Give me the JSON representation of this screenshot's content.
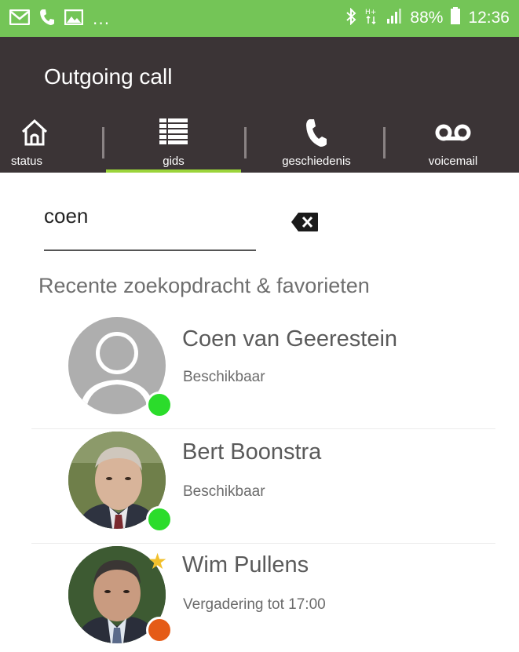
{
  "status_bar": {
    "battery": "88%",
    "time": "12:36",
    "dots": "...",
    "icons": [
      "mail-icon",
      "phone-icon",
      "image-icon",
      "bluetooth-icon",
      "mobile-data-icon",
      "signal-icon",
      "battery-icon"
    ]
  },
  "header": {
    "title": "Outgoing call",
    "active_tab_color": "#9bd43a",
    "tabs": [
      {
        "label": "status",
        "icon": "home-icon"
      },
      {
        "label": "gids",
        "icon": "list-icon"
      },
      {
        "label": "geschiedenis",
        "icon": "phone-icon"
      },
      {
        "label": "voicemail",
        "icon": "voicemail-icon"
      }
    ],
    "active_tab": "gids"
  },
  "search": {
    "value": "coen",
    "clear_icon": "backspace-clear-icon"
  },
  "section": {
    "title": "Recente zoekopdracht & favorieten"
  },
  "contacts": [
    {
      "name": "Coen van Geerestein",
      "status": "Beschikbaar",
      "presence": "available",
      "presence_color": "#2bdc2b",
      "favorite": false
    },
    {
      "name": "Bert Boonstra",
      "status": "Beschikbaar",
      "presence": "available",
      "presence_color": "#2bdc2b",
      "favorite": false
    },
    {
      "name": "Wim Pullens",
      "status": "Vergadering tot 17:00",
      "presence": "busy",
      "presence_color": "#e55b17",
      "favorite": true
    }
  ],
  "colors": {
    "status_bar": "#74c557",
    "header": "#3b3436"
  }
}
